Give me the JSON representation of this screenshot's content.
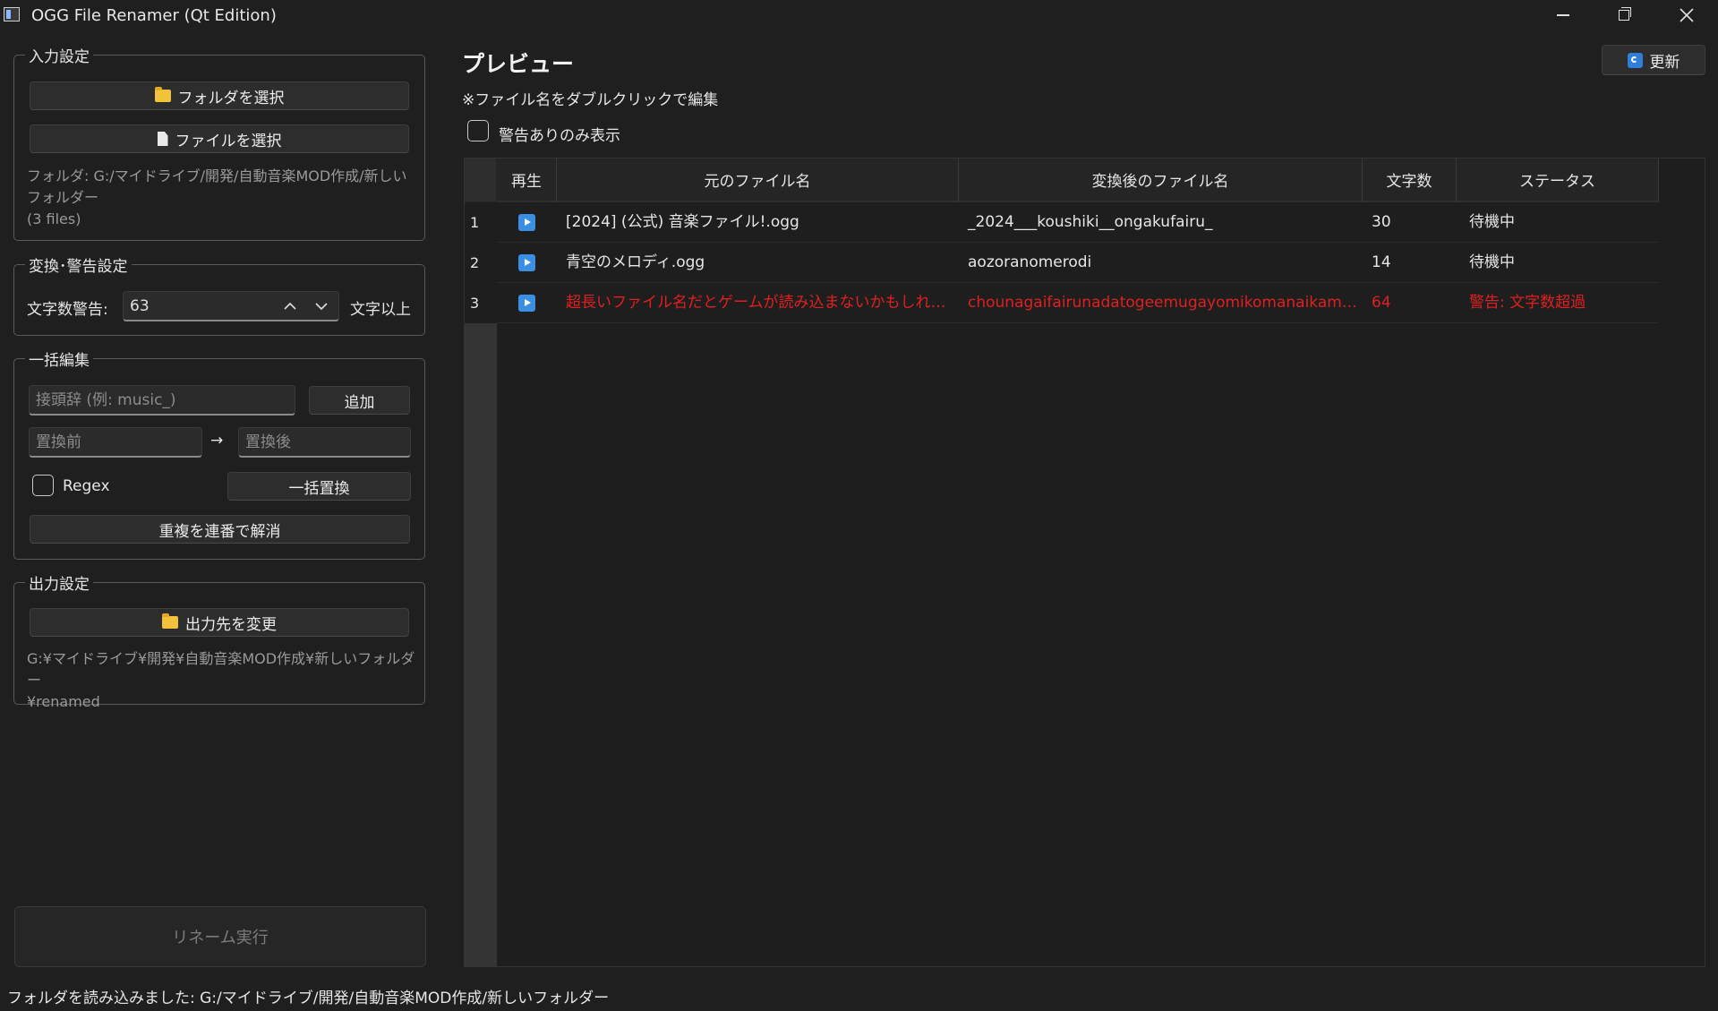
{
  "window": {
    "title": "OGG File Renamer (Qt Edition)"
  },
  "input_settings": {
    "title": "入力設定",
    "select_folder_label": "フォルダを選択",
    "select_file_label": "ファイルを選択",
    "folder_info_line1": "フォルダ: G:/マイドライブ/開発/自動音楽MOD作成/新しい",
    "folder_info_line2": "フォルダー",
    "folder_info_line3": "(3 files)"
  },
  "convert_settings": {
    "title": "変換･警告設定",
    "char_warning_label": "文字数警告:",
    "char_warning_value": "63",
    "char_warning_suffix": "文字以上"
  },
  "batch_edit": {
    "title": "一括編集",
    "prefix_placeholder": "接頭辞 (例: music_)",
    "add_label": "追加",
    "replace_from_placeholder": "置換前",
    "arrow": "→",
    "replace_to_placeholder": "置換後",
    "regex_label": "Regex",
    "regex_checked": false,
    "replace_all_label": "一括置換",
    "dedupe_label": "重複を連番で解消"
  },
  "output_settings": {
    "title": "出力設定",
    "change_output_label": "出力先を変更",
    "output_path_line1": "G:¥マイドライブ¥開発¥自動音楽MOD作成¥新しいフォルダー",
    "output_path_line2": "¥renamed"
  },
  "run_button_label": "リネーム実行",
  "status_bar_text": "フォルダを読み込みました: G:/マイドライブ/開発/自動音楽MOD作成/新しいフォルダー",
  "preview": {
    "title": "プレビュー",
    "refresh_label": "更新",
    "hint": "※ファイル名をダブルクリックで編集",
    "warnings_only_label": "警告ありのみ表示",
    "warnings_only_checked": false,
    "columns": [
      "再生",
      "元のファイル名",
      "変換後のファイル名",
      "文字数",
      "ステータス"
    ],
    "rows": [
      {
        "num": "1",
        "original": "[2024] (公式) 音楽ファイル!.ogg",
        "converted": "_2024___koushiki__ongakufairu_",
        "length": "30",
        "status": "待機中",
        "warning": false
      },
      {
        "num": "2",
        "original": "青空のメロディ.ogg",
        "converted": "aozoranomerodi",
        "length": "14",
        "status": "待機中",
        "warning": false
      },
      {
        "num": "3",
        "original": "超長いファイル名だとゲームが読み込まないかもしれないテス...",
        "converted": "chounagaifairunadatogeemugayomikomanaikamos...",
        "length": "64",
        "status": "警告: 文字数超過",
        "warning": true
      }
    ]
  },
  "colors": {
    "background": "#1f1f1f",
    "warning": "#e02020",
    "accent": "#3a8fe3"
  },
  "icons": [
    "folder-icon",
    "file-icon",
    "chevron-up-icon",
    "chevron-down-icon",
    "refresh-icon",
    "play-icon"
  ]
}
